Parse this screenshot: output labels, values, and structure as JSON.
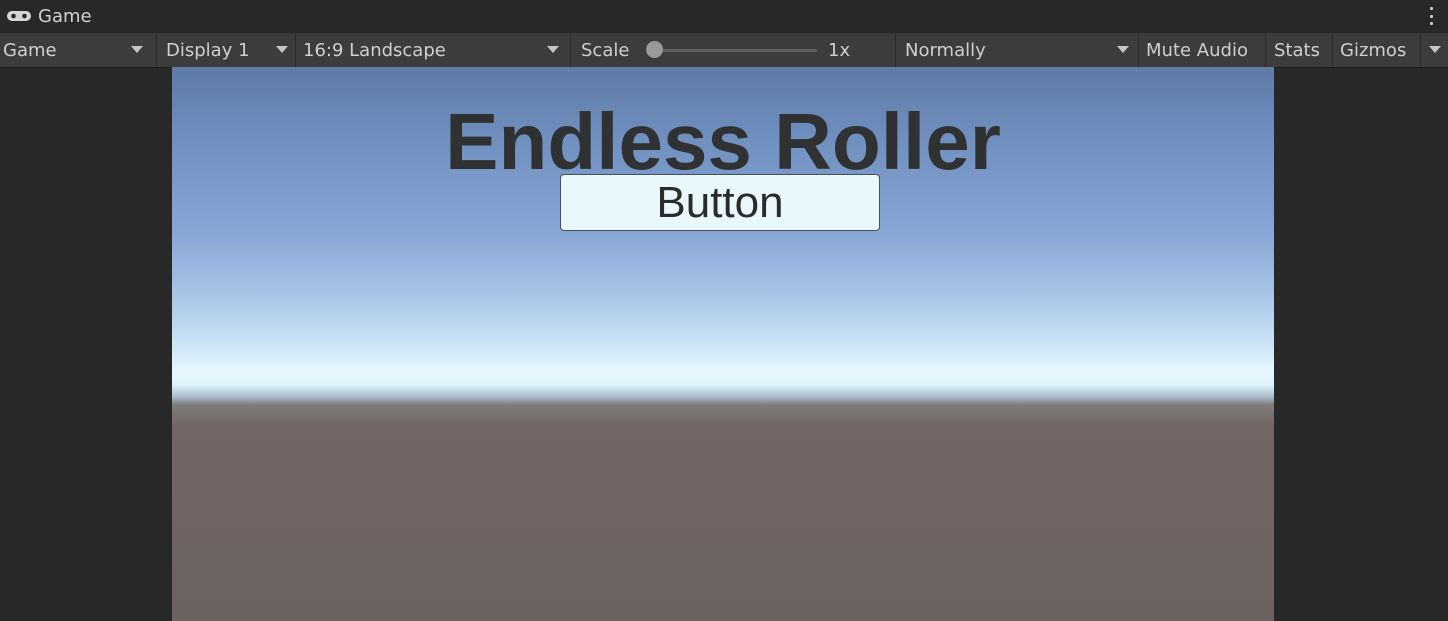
{
  "window": {
    "tab_title": "Game",
    "tab_icon": "gamepad-icon"
  },
  "toolbar": {
    "view_mode": "Game",
    "display": "Display 1",
    "aspect": "16:9 Landscape",
    "scale_label": "Scale",
    "scale_value": "1x",
    "scale_level": 0.0,
    "play_mode": "Normally",
    "mute_audio": "Mute Audio",
    "stats": "Stats",
    "gizmos": "Gizmos"
  },
  "game": {
    "title": "Endless Roller",
    "button_label": "Button"
  },
  "colors": {
    "editor_bg": "#282828",
    "toolbar_bg": "#3c3c3c",
    "sky_top": "#5e7aa5",
    "horizon": "#e6f6fc",
    "ground": "#6c6260",
    "button_bg": "#e8f8fb"
  }
}
